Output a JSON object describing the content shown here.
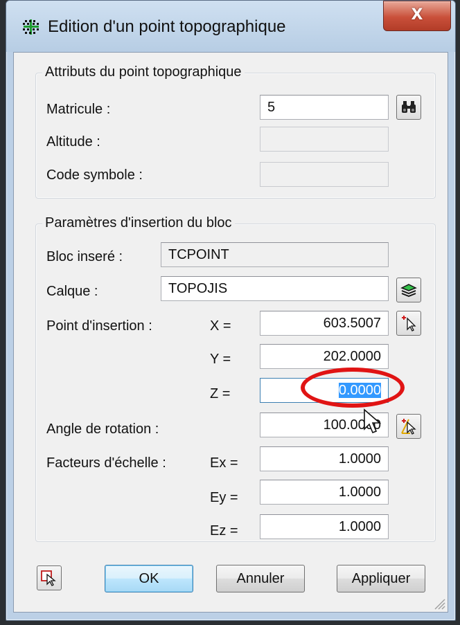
{
  "window": {
    "title": "Edition d'un point topographique",
    "close_glyph": "X",
    "app_icon": "grid-dots-icon"
  },
  "attributes": {
    "legend": "Attributs du point topographique",
    "matricule_label": "Matricule :",
    "matricule_value": "5",
    "altitude_label": "Altitude :",
    "altitude_value": "",
    "code_label": "Code symbole :",
    "code_value": "",
    "search_icon": "binoculars-icon"
  },
  "insertion": {
    "legend": "Paramètres d'insertion du bloc",
    "bloc_label": "Bloc inseré :",
    "bloc_value": "TCPOINT",
    "calque_label": "Calque :",
    "calque_value": "TOPOJIS",
    "layers_icon": "layers-icon",
    "point_label": "Point d'insertion :",
    "x_label": "X =",
    "x_value": "603.5007",
    "y_label": "Y =",
    "y_value": "202.0000",
    "z_label": "Z =",
    "z_value": "0.0000",
    "pick_point_icon": "pick-point-icon",
    "angle_label": "Angle de rotation :",
    "angle_value": "100.0000",
    "pick_angle_icon": "pick-angle-icon",
    "scale_label": "Facteurs d'échelle :",
    "ex_label": "Ex =",
    "ex_value": "1.0000",
    "ey_label": "Ey =",
    "ey_value": "1.0000",
    "ez_label": "Ez =",
    "ez_value": "1.0000"
  },
  "footer": {
    "select_icon": "select-object-icon",
    "ok_label": "OK",
    "cancel_label": "Annuler",
    "apply_label": "Appliquer"
  },
  "colors": {
    "annotation": "#e01414",
    "selection": "#3399ff",
    "close_button": "#c9503a"
  }
}
